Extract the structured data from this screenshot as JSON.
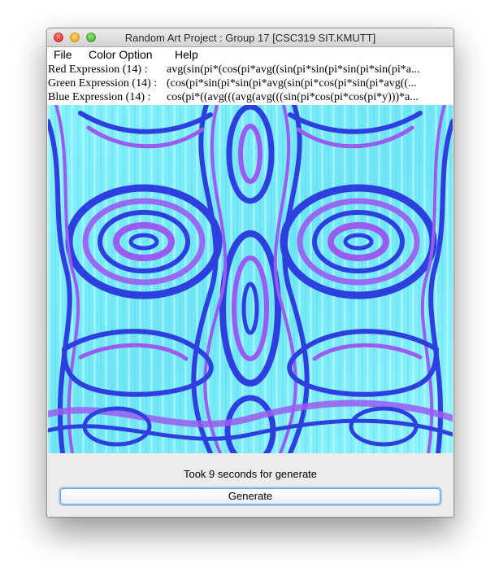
{
  "window": {
    "title": "Random Art Project : Group 17 [CSC319 SIT.KMUTT]"
  },
  "menu": {
    "file": "File",
    "color_option": "Color Option",
    "help": "Help"
  },
  "expressions": {
    "red_label": "Red Expression (14)    :",
    "red_value": "avg(sin(pi*(cos(pi*avg((sin(pi*sin(pi*sin(pi*sin(pi*a...",
    "green_label": "Green Expression (14) :",
    "green_value": "(cos(pi*sin(pi*sin(pi*avg(sin(pi*cos(pi*sin(pi*avg((...",
    "blue_label": "Blue Expression (14)   :",
    "blue_value": "cos(pi*((avg(((avg(avg(((sin(pi*cos(pi*cos(pi*y)))*a..."
  },
  "status": {
    "message": "Took 9 seconds for generate"
  },
  "buttons": {
    "generate": "Generate"
  },
  "colors": {
    "art_background": "#7ff0f8",
    "art_blue": "#2e3fe0",
    "art_violet": "#9a5cf0",
    "art_light": "#b6f8ff",
    "button_focus": "#a7c8ee"
  }
}
